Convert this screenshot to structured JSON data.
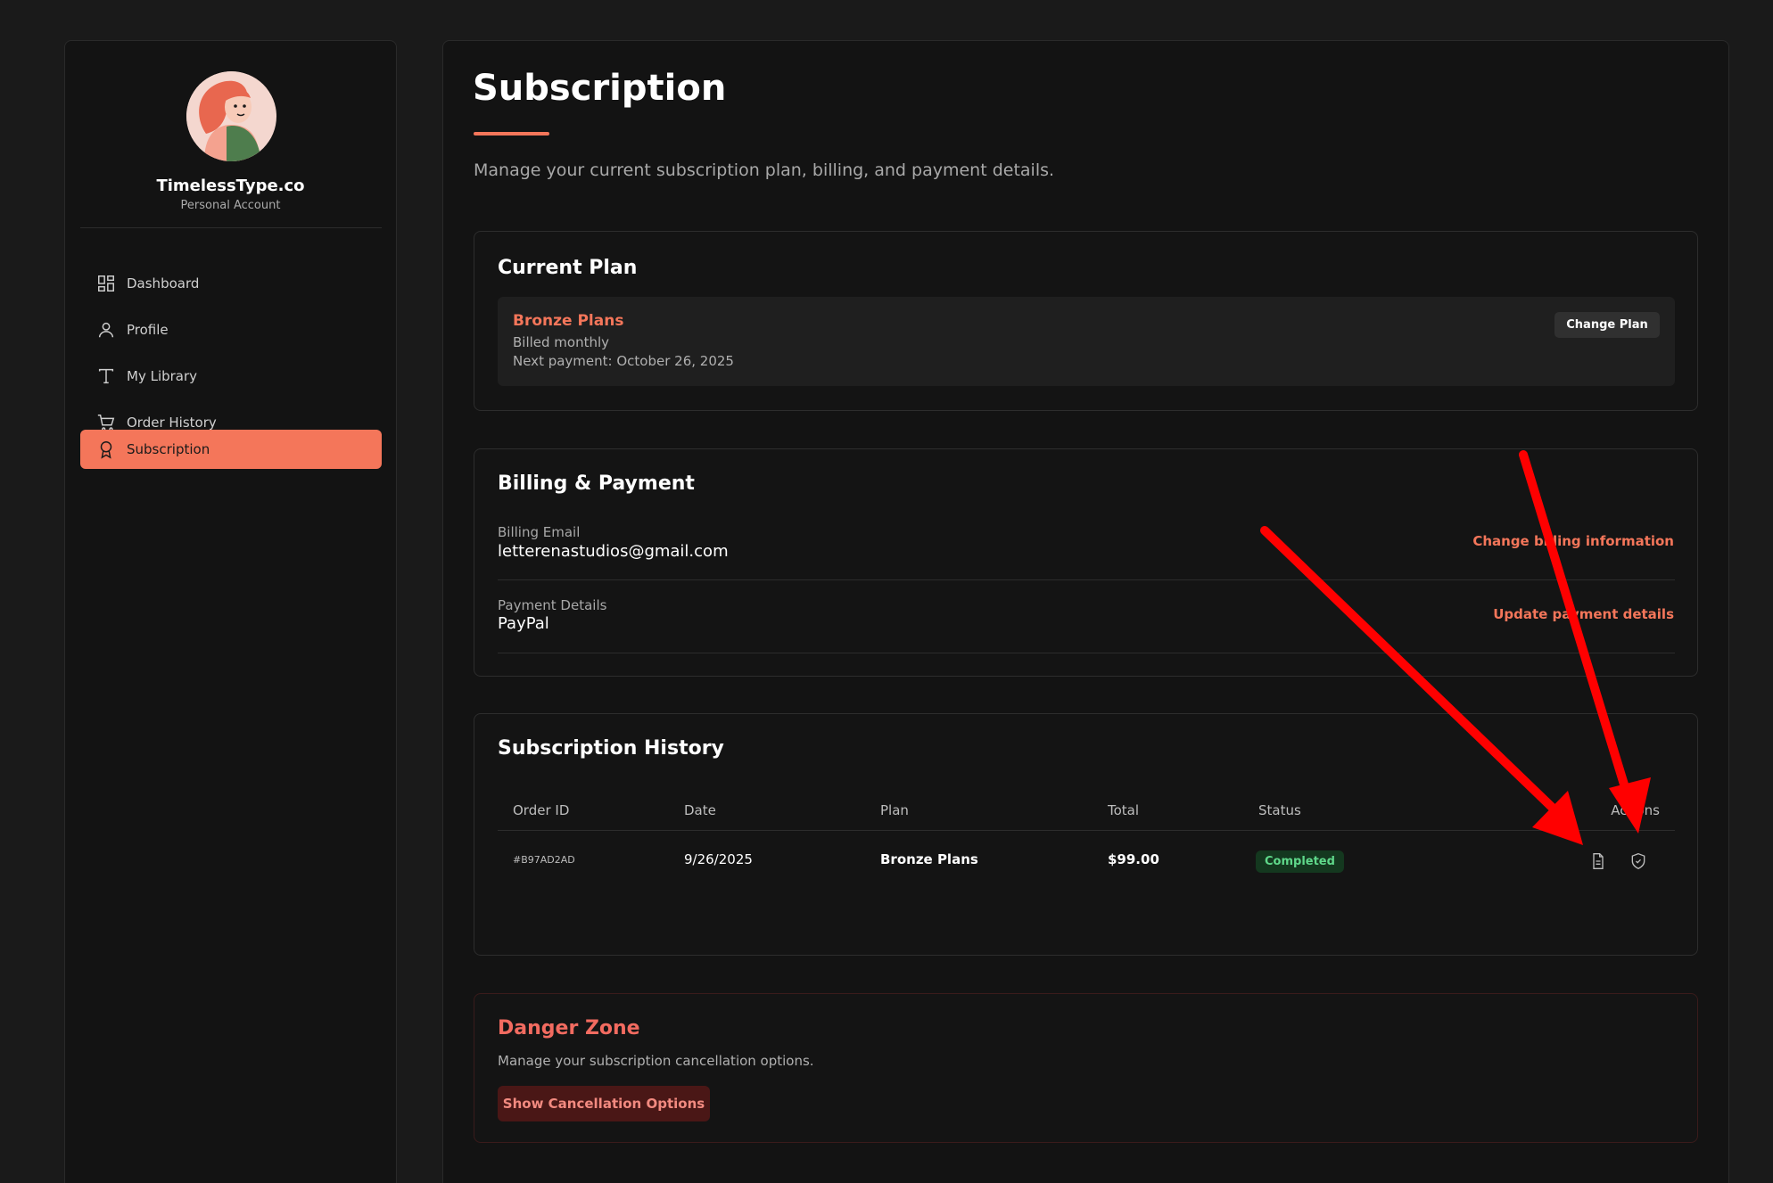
{
  "sidebar": {
    "brand": "TimelessType.co",
    "account_type": "Personal Account",
    "items": [
      {
        "label": "Dashboard",
        "icon": "dashboard-icon"
      },
      {
        "label": "Profile",
        "icon": "user-icon"
      },
      {
        "label": "My Library",
        "icon": "type-icon"
      },
      {
        "label": "Order History",
        "icon": "cart-icon"
      },
      {
        "label": "Subscription",
        "icon": "award-icon",
        "active": true
      }
    ]
  },
  "page": {
    "title": "Subscription",
    "subtitle": "Manage your current subscription plan, billing, and payment details."
  },
  "current_plan": {
    "title": "Current Plan",
    "plan_name": "Bronze Plans",
    "billing_cycle": "Billed monthly",
    "next_payment": "Next payment: October 26, 2025",
    "change_button": "Change Plan"
  },
  "billing": {
    "title": "Billing & Payment",
    "email_label": "Billing Email",
    "email_value": "letterenastudios@gmail.com",
    "email_link": "Change billing information",
    "payment_label": "Payment Details",
    "payment_value": "PayPal",
    "payment_link": "Update payment details"
  },
  "history": {
    "title": "Subscription History",
    "columns": [
      "Order ID",
      "Date",
      "Plan",
      "Total",
      "Status",
      "Actions"
    ],
    "rows": [
      {
        "order_id": "#B97AD2AD",
        "date": "9/26/2025",
        "plan": "Bronze Plans",
        "total": "$99.00",
        "status": "Completed"
      }
    ]
  },
  "danger": {
    "title": "Danger Zone",
    "subtitle": "Manage your subscription cancellation options.",
    "button": "Show Cancellation Options"
  },
  "colors": {
    "accent": "#f4765a",
    "success": "#5fd88a",
    "danger": "#f26b60",
    "annotation_arrow": "#ff0000"
  }
}
